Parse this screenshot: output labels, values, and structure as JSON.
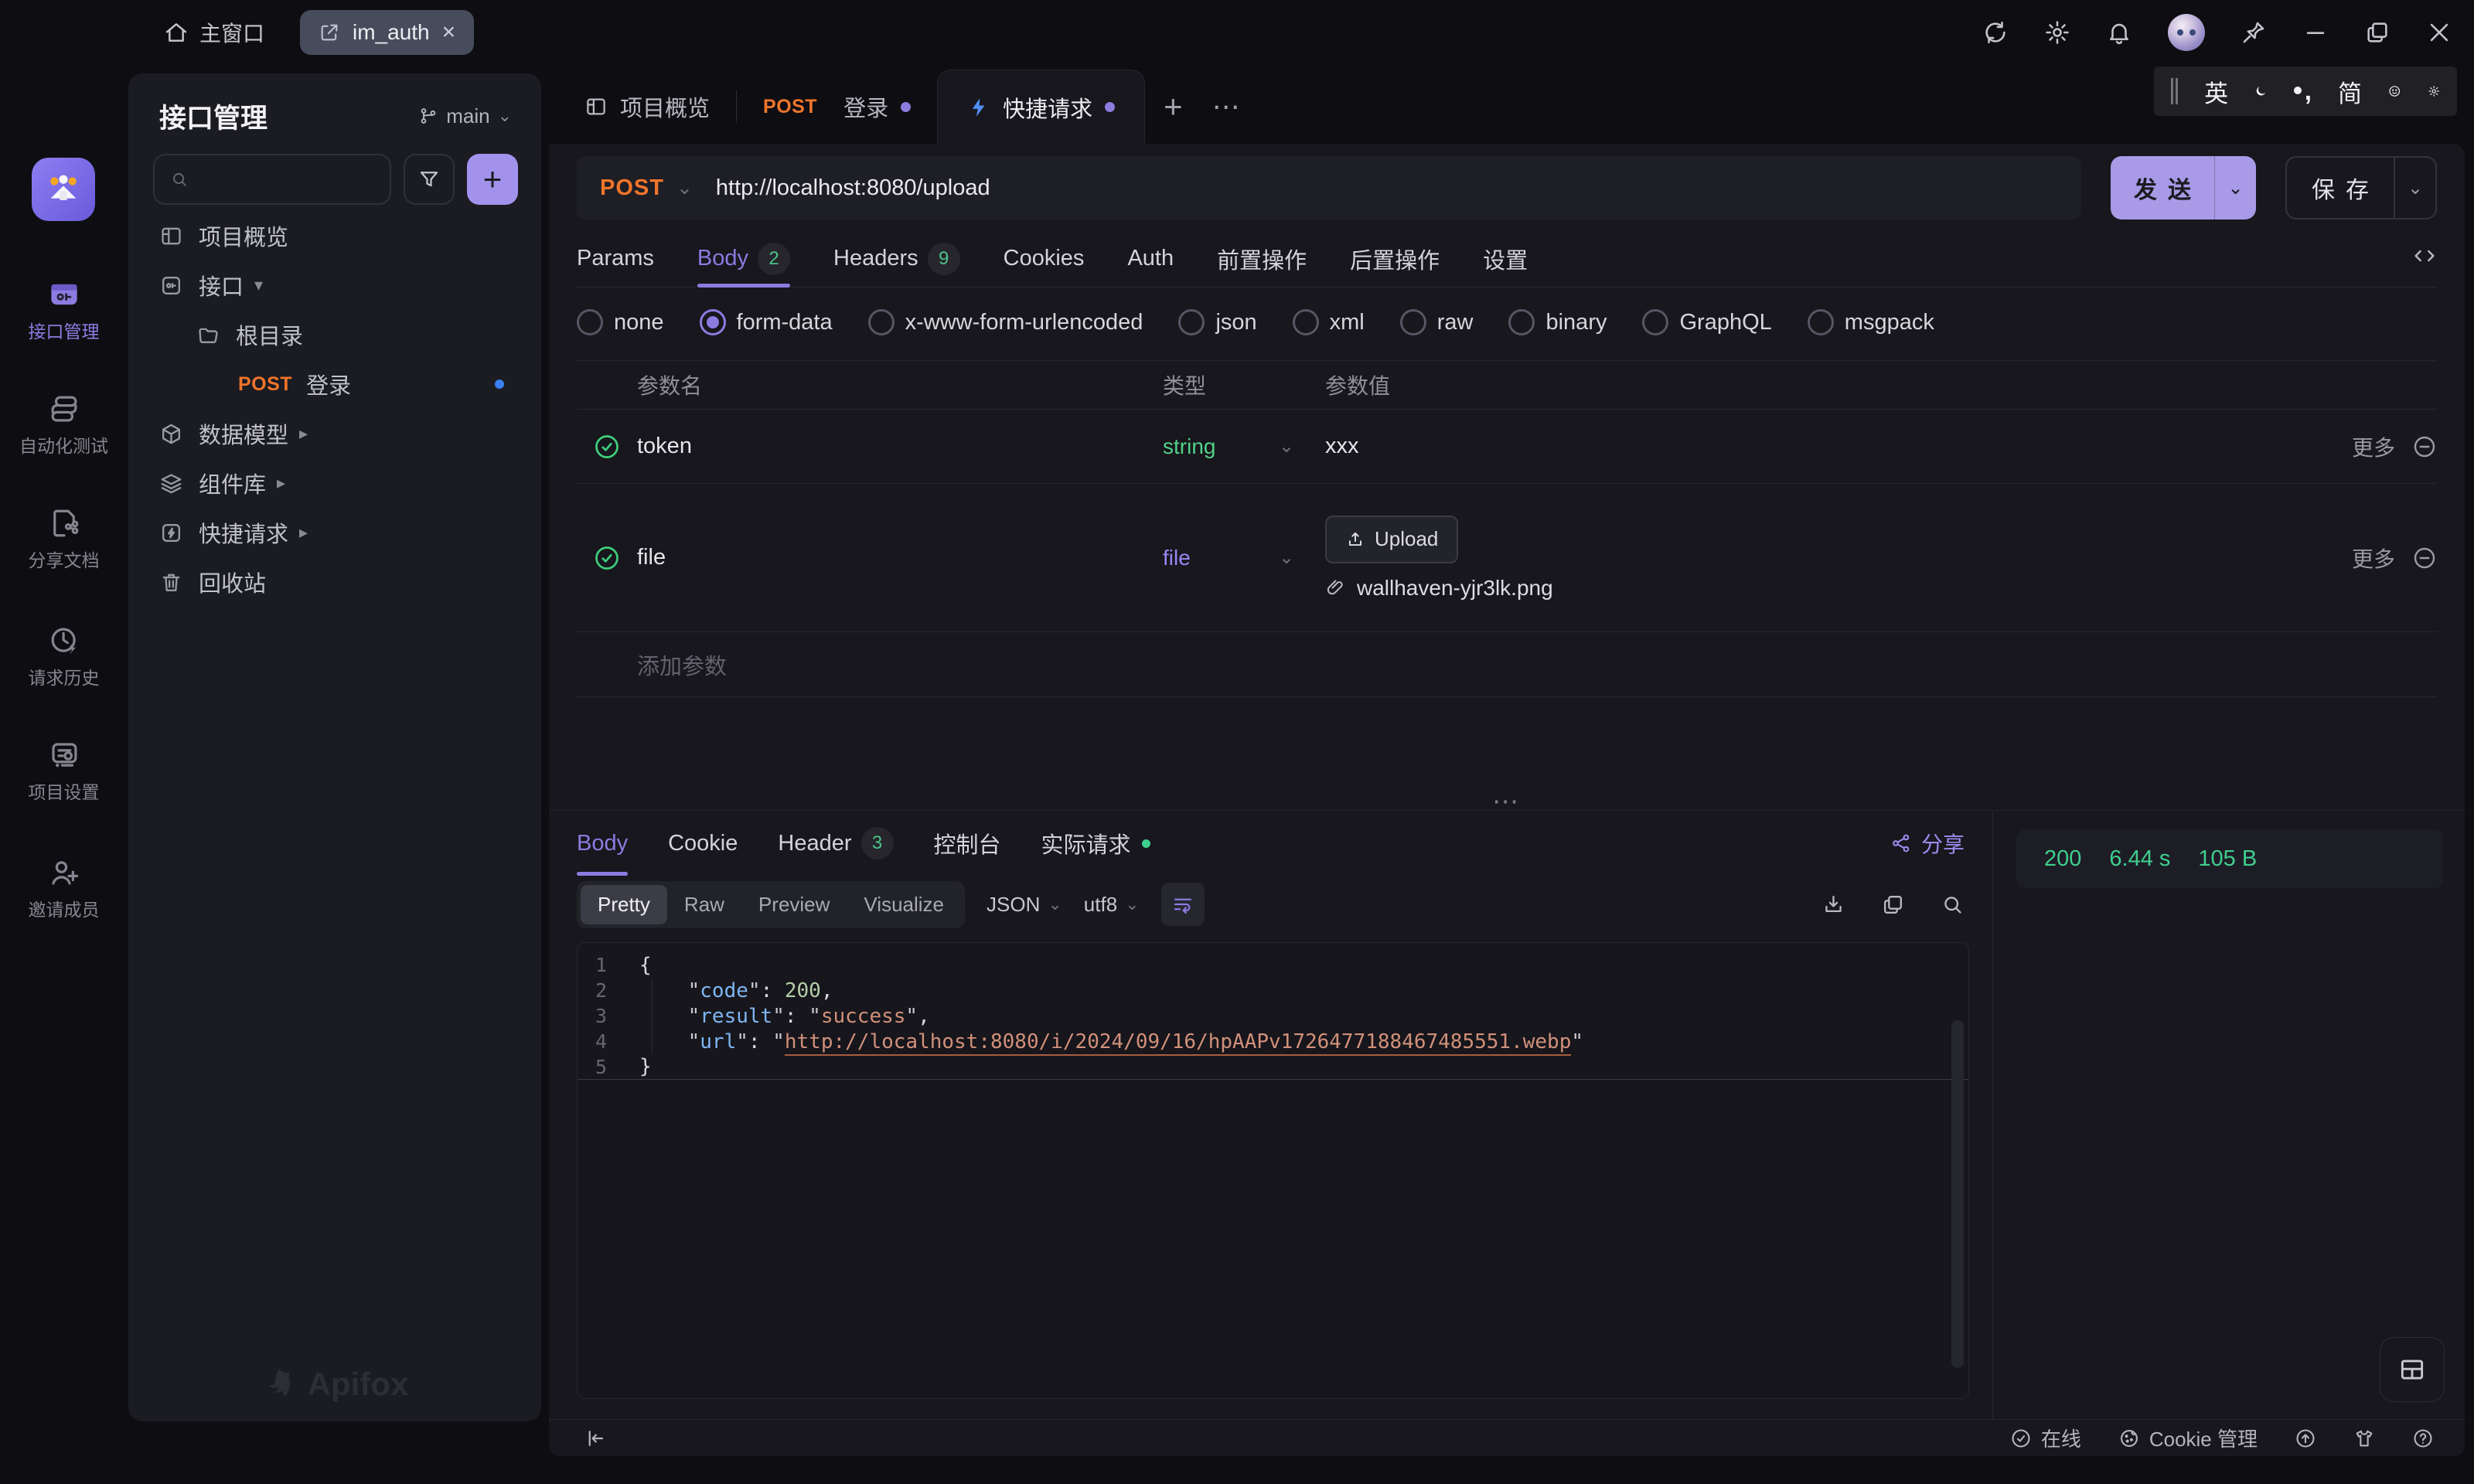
{
  "titlebar": {
    "home_label": "主窗口",
    "window_tab": "im_auth"
  },
  "ime": {
    "lang": "英",
    "charset": "简"
  },
  "rail": {
    "items": [
      {
        "label": "接口管理"
      },
      {
        "label": "自动化测试"
      },
      {
        "label": "分享文档"
      },
      {
        "label": "请求历史"
      },
      {
        "label": "项目设置"
      },
      {
        "label": "邀请成员"
      }
    ]
  },
  "sidebar": {
    "title": "接口管理",
    "branch": "main",
    "tree": {
      "overview": "项目概览",
      "api_group": "接口",
      "root_folder": "根目录",
      "endpoint": {
        "method": "POST",
        "name": "登录"
      },
      "data_models": "数据模型",
      "components": "组件库",
      "quick_request": "快捷请求",
      "trash": "回收站"
    },
    "brand": "Apifox"
  },
  "doc_tabs": {
    "overview": "项目概览",
    "login": {
      "method": "POST",
      "name": "登录"
    },
    "quick": "快捷请求"
  },
  "request": {
    "method": "POST",
    "url": "http://localhost:8080/upload",
    "send": "发送",
    "save": "保存",
    "tabs": {
      "params": "Params",
      "body": "Body",
      "body_badge": "2",
      "headers": "Headers",
      "headers_badge": "9",
      "cookies": "Cookies",
      "auth": "Auth",
      "pre_ops": "前置操作",
      "post_ops": "后置操作",
      "settings": "设置"
    },
    "body_types": [
      "none",
      "form-data",
      "x-www-form-urlencoded",
      "json",
      "xml",
      "raw",
      "binary",
      "GraphQL",
      "msgpack"
    ],
    "selected_body_type": "form-data",
    "table": {
      "col_name": "参数名",
      "col_type": "类型",
      "col_value": "参数值",
      "rows": [
        {
          "name": "token",
          "type": "string",
          "value": "xxx",
          "more": "更多"
        },
        {
          "name": "file",
          "type": "file",
          "upload": "Upload",
          "file": "wallhaven-yjr3lk.png",
          "more": "更多"
        }
      ],
      "add_label": "添加参数"
    }
  },
  "response": {
    "tabs": {
      "body": "Body",
      "cookie": "Cookie",
      "header": "Header",
      "header_badge": "3",
      "console": "控制台",
      "actual": "实际请求"
    },
    "share": "分享",
    "status": {
      "code": "200",
      "time": "6.44 s",
      "size": "105 B"
    },
    "views": [
      "Pretty",
      "Raw",
      "Preview",
      "Visualize"
    ],
    "format": "JSON",
    "encoding": "utf8",
    "code": {
      "line_numbers": [
        "1",
        "2",
        "3",
        "4",
        "5"
      ],
      "tokens": {
        "open": "{",
        "close": "}",
        "q": "\"",
        "colon": ": ",
        "comma": ",",
        "key_code": "code",
        "key_result": "result",
        "key_url": "url",
        "val_code": "200",
        "val_result": "success",
        "val_url": "http://localhost:8080/i/2024/09/16/hpAAPv1726477188467485551.webp"
      }
    }
  },
  "statusbar": {
    "online": "在线",
    "cookie_manager": "Cookie 管理"
  },
  "icons": {
    "plus": "+",
    "close": "×",
    "more_horizontal": "⋯",
    "chevron_down": "⌄",
    "caret_down": "▾",
    "caret_right": "▸"
  },
  "colors": {
    "accent_purple": "#8b7ce0",
    "send_purple": "#a89ae6",
    "method_orange": "#f0752b",
    "success_green": "#3ecf8e",
    "badge_green": "#4cc38a",
    "endpoint_dot_blue": "#3b7ef0",
    "code_key": "#7fb5f2",
    "code_string": "#d2907a",
    "code_number": "#b5cea8"
  }
}
